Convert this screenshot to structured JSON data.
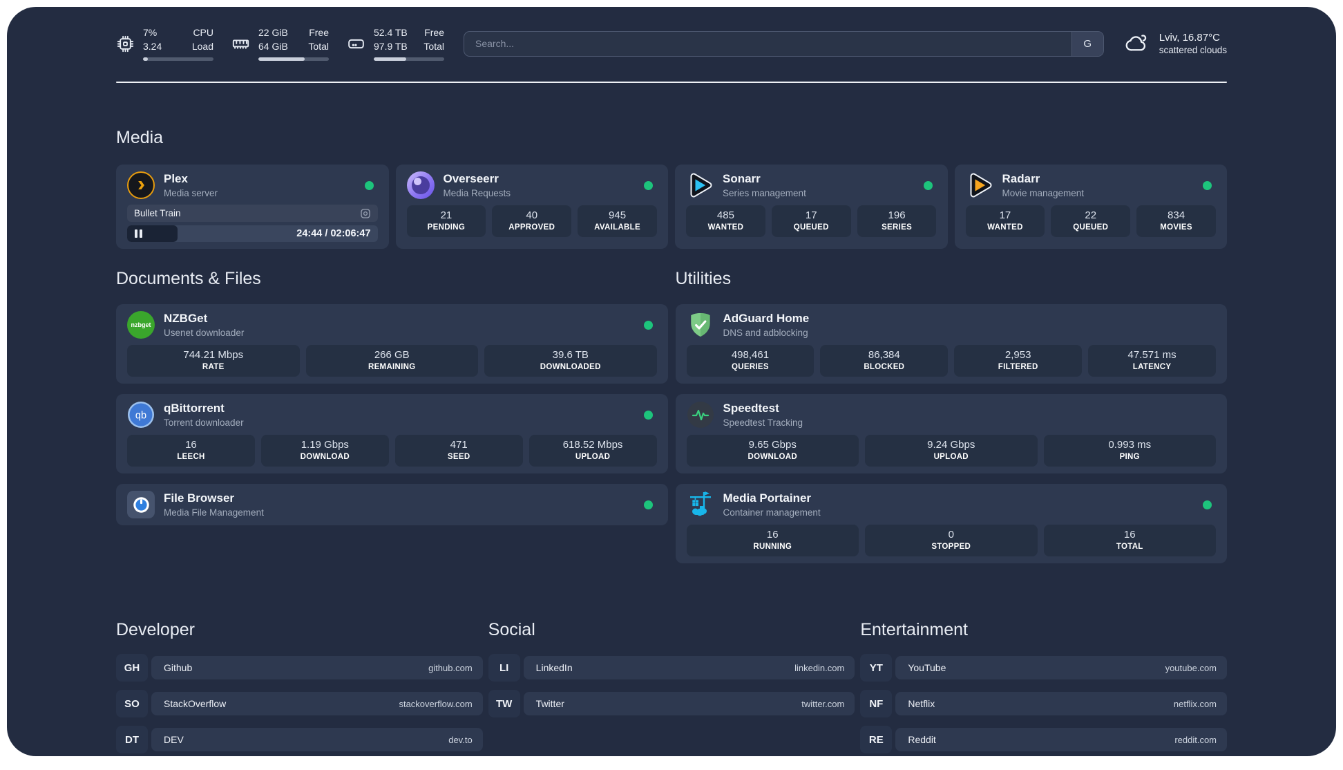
{
  "colors": {
    "background": "#232c41",
    "card": "#2e3950",
    "status_online": "#1dc47c",
    "plex_amber": "#eba10d",
    "sonarr_blue": "#2bc1f3",
    "radarr_orange": "#f6a51f",
    "nzbget_green": "#3aa62c",
    "qbittorrent_blue": "#3f79d5",
    "adguard_green": "#68b873",
    "speedtest_pulse": "#3ad07f",
    "filebrowser_blue": "#2f7fdf",
    "portainer_blue": "#18b6ea",
    "overseerr_purple": "#8d77f2"
  },
  "header": {
    "system_stats": [
      {
        "icon": "cpu-icon",
        "values": [
          "7%",
          "3.24"
        ],
        "labels": [
          "CPU",
          "Load"
        ],
        "progress_pct": 7
      },
      {
        "icon": "memory-icon",
        "values": [
          "22 GiB",
          "64 GiB"
        ],
        "labels": [
          "Free",
          "Total"
        ],
        "progress_pct": 66
      },
      {
        "icon": "disk-icon",
        "values": [
          "52.4 TB",
          "97.9 TB"
        ],
        "labels": [
          "Free",
          "Total"
        ],
        "progress_pct": 46
      }
    ],
    "search": {
      "placeholder": "Search...",
      "engine_badge": "G"
    },
    "weather": {
      "location": "Lviv, 16.87°C",
      "condition": "scattered clouds"
    }
  },
  "media": {
    "title": "Media",
    "cards": {
      "plex": {
        "name": "Plex",
        "description": "Media server",
        "icon": "plex-icon",
        "status": "online",
        "player": {
          "title": "Bullet Train",
          "state": "paused",
          "time": "24:44 / 02:06:47",
          "progress_pct": 20
        }
      },
      "overseerr": {
        "name": "Overseerr",
        "description": "Media Requests",
        "icon": "overseerr-icon",
        "status": "online",
        "stats": [
          {
            "value": "21",
            "label": "PENDING"
          },
          {
            "value": "40",
            "label": "APPROVED"
          },
          {
            "value": "945",
            "label": "AVAILABLE"
          }
        ]
      },
      "sonarr": {
        "name": "Sonarr",
        "description": "Series management",
        "icon": "sonarr-icon",
        "status": "online",
        "stats": [
          {
            "value": "485",
            "label": "WANTED"
          },
          {
            "value": "17",
            "label": "QUEUED"
          },
          {
            "value": "196",
            "label": "SERIES"
          }
        ]
      },
      "radarr": {
        "name": "Radarr",
        "description": "Movie management",
        "icon": "radarr-icon",
        "status": "online",
        "stats": [
          {
            "value": "17",
            "label": "WANTED"
          },
          {
            "value": "22",
            "label": "QUEUED"
          },
          {
            "value": "834",
            "label": "MOVIES"
          }
        ]
      }
    }
  },
  "documents_files": {
    "title": "Documents & Files",
    "cards": {
      "nzbget": {
        "name": "NZBGet",
        "description": "Usenet downloader",
        "icon": "nzbget-icon",
        "icon_text": "nzbget",
        "status": "online",
        "stats": [
          {
            "value": "744.21 Mbps",
            "label": "RATE"
          },
          {
            "value": "266 GB",
            "label": "REMAINING"
          },
          {
            "value": "39.6 TB",
            "label": "DOWNLOADED"
          }
        ]
      },
      "qbittorrent": {
        "name": "qBittorrent",
        "description": "Torrent downloader",
        "icon": "qbittorrent-icon",
        "icon_text": "qb",
        "status": "online",
        "stats": [
          {
            "value": "16",
            "label": "LEECH"
          },
          {
            "value": "1.19 Gbps",
            "label": "DOWNLOAD"
          },
          {
            "value": "471",
            "label": "SEED"
          },
          {
            "value": "618.52 Mbps",
            "label": "UPLOAD"
          }
        ]
      },
      "filebrowser": {
        "name": "File Browser",
        "description": "Media File Management",
        "icon": "filebrowser-icon",
        "status": "online"
      }
    }
  },
  "utilities": {
    "title": "Utilities",
    "cards": {
      "adguard": {
        "name": "AdGuard Home",
        "description": "DNS and adblocking",
        "icon": "adguard-icon",
        "status": "online",
        "stats": [
          {
            "value": "498,461",
            "label": "QUERIES"
          },
          {
            "value": "86,384",
            "label": "BLOCKED"
          },
          {
            "value": "2,953",
            "label": "FILTERED"
          },
          {
            "value": "47.571 ms",
            "label": "LATENCY"
          }
        ]
      },
      "speedtest": {
        "name": "Speedtest",
        "description": "Speedtest Tracking",
        "icon": "speedtest-icon",
        "status": "none",
        "stats": [
          {
            "value": "9.65 Gbps",
            "label": "DOWNLOAD"
          },
          {
            "value": "9.24 Gbps",
            "label": "UPLOAD"
          },
          {
            "value": "0.993 ms",
            "label": "PING"
          }
        ]
      },
      "portainer": {
        "name": "Media Portainer",
        "description": "Container management",
        "icon": "portainer-icon",
        "status": "online",
        "stats": [
          {
            "value": "16",
            "label": "RUNNING"
          },
          {
            "value": "0",
            "label": "STOPPED"
          },
          {
            "value": "16",
            "label": "TOTAL"
          }
        ]
      }
    }
  },
  "bookmarks": {
    "developer": {
      "title": "Developer",
      "links": [
        {
          "abbr": "GH",
          "name": "Github",
          "url": "github.com"
        },
        {
          "abbr": "SO",
          "name": "StackOverflow",
          "url": "stackoverflow.com"
        },
        {
          "abbr": "DT",
          "name": "DEV",
          "url": "dev.to"
        }
      ]
    },
    "social": {
      "title": "Social",
      "links": [
        {
          "abbr": "LI",
          "name": "LinkedIn",
          "url": "linkedin.com"
        },
        {
          "abbr": "TW",
          "name": "Twitter",
          "url": "twitter.com"
        }
      ]
    },
    "entertainment": {
      "title": "Entertainment",
      "links": [
        {
          "abbr": "YT",
          "name": "YouTube",
          "url": "youtube.com"
        },
        {
          "abbr": "NF",
          "name": "Netflix",
          "url": "netflix.com"
        },
        {
          "abbr": "RE",
          "name": "Reddit",
          "url": "reddit.com"
        }
      ]
    }
  }
}
